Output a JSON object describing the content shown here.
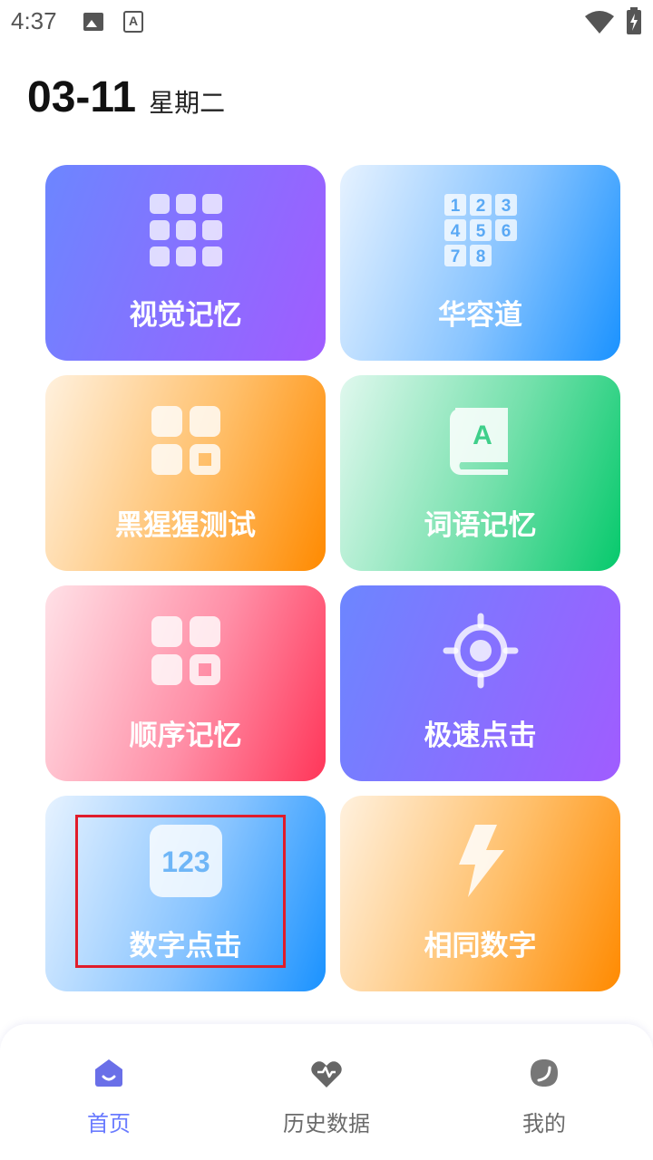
{
  "status_bar": {
    "time": "4:37",
    "a_icon_letter": "A"
  },
  "header": {
    "date": "03-11",
    "weekday": "星期二"
  },
  "cards": [
    {
      "label": "视觉记忆",
      "icon": "grid-dots-icon"
    },
    {
      "label": "华容道",
      "icon": "number-puzzle-icon",
      "digits": [
        "1",
        "2",
        "3",
        "4",
        "5",
        "6",
        "7",
        "8"
      ]
    },
    {
      "label": "黑猩猩测试",
      "icon": "app-grid-icon"
    },
    {
      "label": "词语记忆",
      "icon": "book-icon",
      "icon_letter": "A"
    },
    {
      "label": "顺序记忆",
      "icon": "app-grid-icon"
    },
    {
      "label": "极速点击",
      "icon": "target-icon"
    },
    {
      "label": "数字点击",
      "icon": "number-123-icon",
      "icon_text": "123"
    },
    {
      "label": "相同数字",
      "icon": "lightning-icon"
    }
  ],
  "nav": {
    "items": [
      {
        "label": "首页",
        "icon": "home-icon",
        "active": true
      },
      {
        "label": "历史数据",
        "icon": "history-icon",
        "active": false
      },
      {
        "label": "我的",
        "icon": "profile-leaf-icon",
        "active": false
      }
    ]
  },
  "colors": {
    "accent": "#6a7bff",
    "highlight": "#e01c2b"
  }
}
